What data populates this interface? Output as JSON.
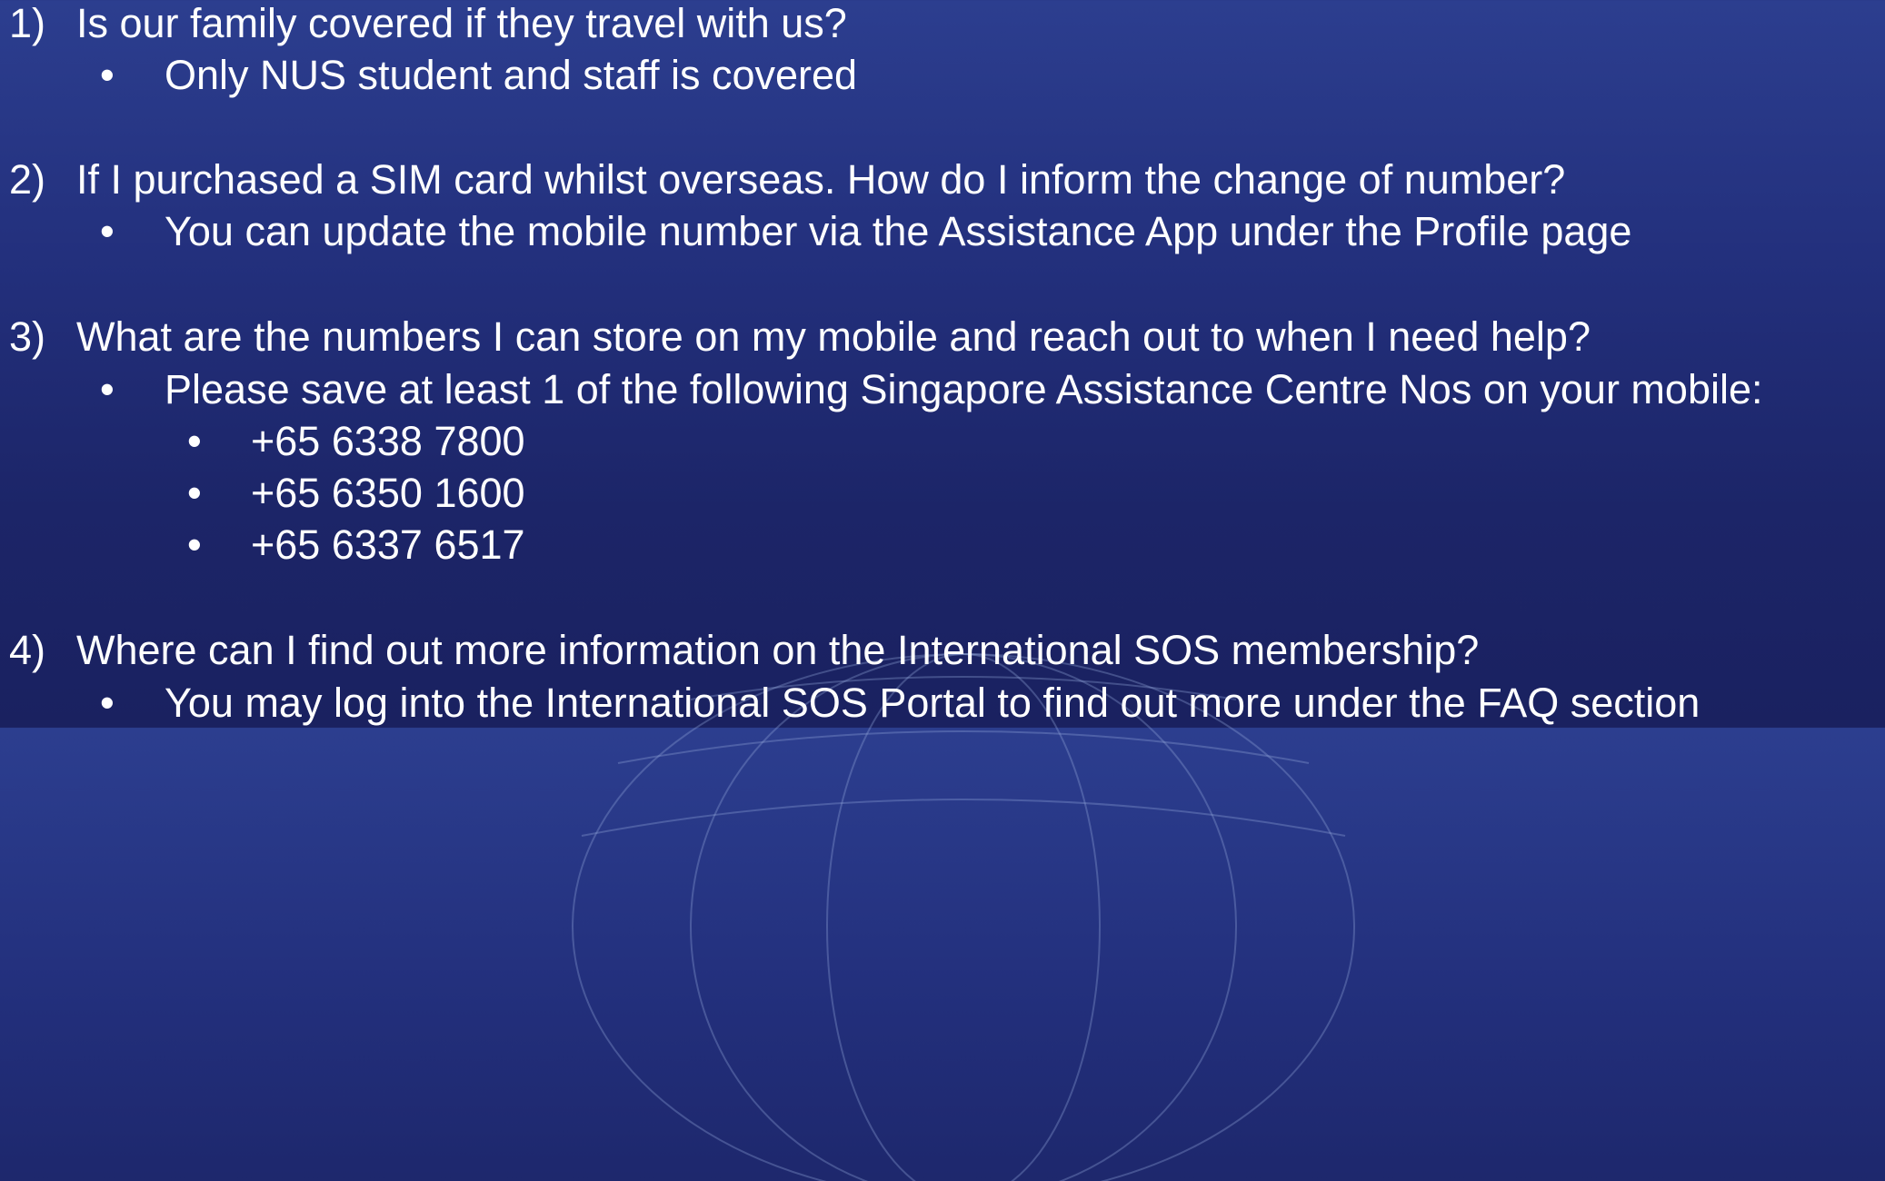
{
  "faq": [
    {
      "number": "1)",
      "question": "Is our family covered if they travel with us?",
      "answer": "Only NUS student and staff is covered"
    },
    {
      "number": "2)",
      "question": "If I purchased a SIM card whilst overseas. How do I inform the change of number?",
      "answer": "You can update the mobile number via the Assistance App under the Profile page"
    },
    {
      "number": "3)",
      "question": "What are the numbers I can store on my mobile and reach out to when I need help?",
      "answer": "Please save at least 1 of the following Singapore Assistance Centre Nos on your mobile:",
      "sub_items": [
        "+65 6338 7800",
        "+65 6350 1600",
        "+65 6337 6517"
      ]
    },
    {
      "number": "4)",
      "question": "Where can I find out more information on the International SOS membership?",
      "answer": "You may log into the International SOS Portal to find out more under the FAQ section"
    }
  ],
  "bullet_glyph": "•",
  "colors": {
    "text": "#ffffff",
    "background_top": "#2c3e8f",
    "background_bottom": "#1a2160"
  },
  "icons": [
    "globe-watermark-icon"
  ]
}
